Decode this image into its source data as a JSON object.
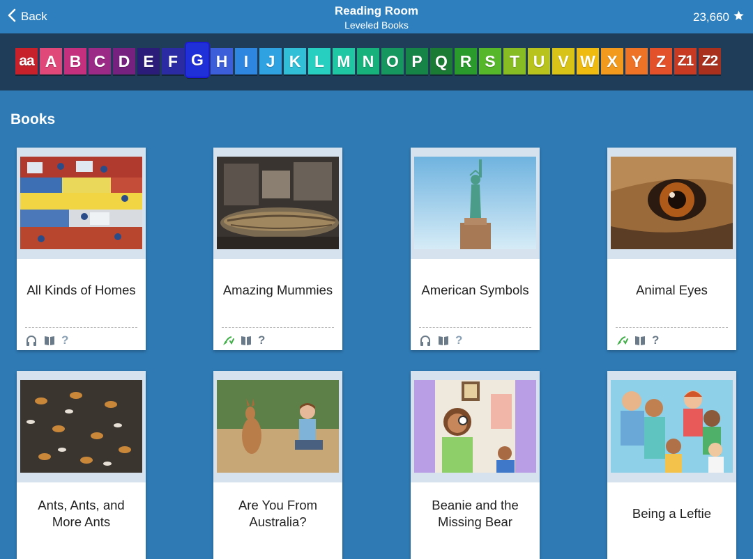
{
  "header": {
    "back_label": "Back",
    "title": "Reading Room",
    "subtitle": "Leveled Books",
    "star_count": "23,660"
  },
  "levels": [
    {
      "label": "aa",
      "color": "#c7222c"
    },
    {
      "label": "A",
      "color": "#e0487a"
    },
    {
      "label": "B",
      "color": "#c5307e"
    },
    {
      "label": "C",
      "color": "#9b2a86"
    },
    {
      "label": "D",
      "color": "#76217f"
    },
    {
      "label": "E",
      "color": "#2a1c78"
    },
    {
      "label": "F",
      "color": "#2b2ba3"
    },
    {
      "label": "G",
      "color": "#1f30d8",
      "selected": true
    },
    {
      "label": "H",
      "color": "#3c5fd9"
    },
    {
      "label": "I",
      "color": "#2f86e0"
    },
    {
      "label": "J",
      "color": "#2fa2e2"
    },
    {
      "label": "K",
      "color": "#31bfd7"
    },
    {
      "label": "L",
      "color": "#27cfc1"
    },
    {
      "label": "M",
      "color": "#1fc7a2"
    },
    {
      "label": "N",
      "color": "#17b27b"
    },
    {
      "label": "O",
      "color": "#179760"
    },
    {
      "label": "P",
      "color": "#168447"
    },
    {
      "label": "Q",
      "color": "#1b7b35"
    },
    {
      "label": "R",
      "color": "#2a9a2c"
    },
    {
      "label": "S",
      "color": "#56b72a"
    },
    {
      "label": "T",
      "color": "#88bc25"
    },
    {
      "label": "U",
      "color": "#b8c31d"
    },
    {
      "label": "V",
      "color": "#d8c319"
    },
    {
      "label": "W",
      "color": "#efbb10"
    },
    {
      "label": "X",
      "color": "#f29a1e"
    },
    {
      "label": "Y",
      "color": "#ef7326"
    },
    {
      "label": "Z",
      "color": "#e2512a"
    },
    {
      "label": "Z1",
      "color": "#c83b22"
    },
    {
      "label": "Z2",
      "color": "#a9301d"
    }
  ],
  "section_title": "Books",
  "books": [
    {
      "title": "All Kinds of Homes",
      "icons": [
        "headphones-icon",
        "book-icon",
        "quiz-icon"
      ]
    },
    {
      "title": "Amazing Mummies",
      "icons": [
        "record-icon",
        "book-icon",
        "quiz-icon"
      ]
    },
    {
      "title": "American Symbols",
      "icons": [
        "headphones-icon",
        "book-icon",
        "quiz-icon"
      ]
    },
    {
      "title": "Animal Eyes",
      "icons": [
        "record-icon",
        "book-icon",
        "quiz-icon"
      ]
    },
    {
      "title": "Ants, Ants, and More Ants",
      "icons": []
    },
    {
      "title": "Are You From Australia?",
      "icons": []
    },
    {
      "title": "Beanie and the Missing Bear",
      "icons": []
    },
    {
      "title": "Being a Leftie",
      "icons": []
    }
  ],
  "quiz_symbol": "?",
  "colors": {
    "page_bg": "#2f7ab4",
    "topbar_bg": "#2e7fbd",
    "levelbar_bg": "#1f3d58",
    "card_img_bg": "#d6e3ee"
  }
}
